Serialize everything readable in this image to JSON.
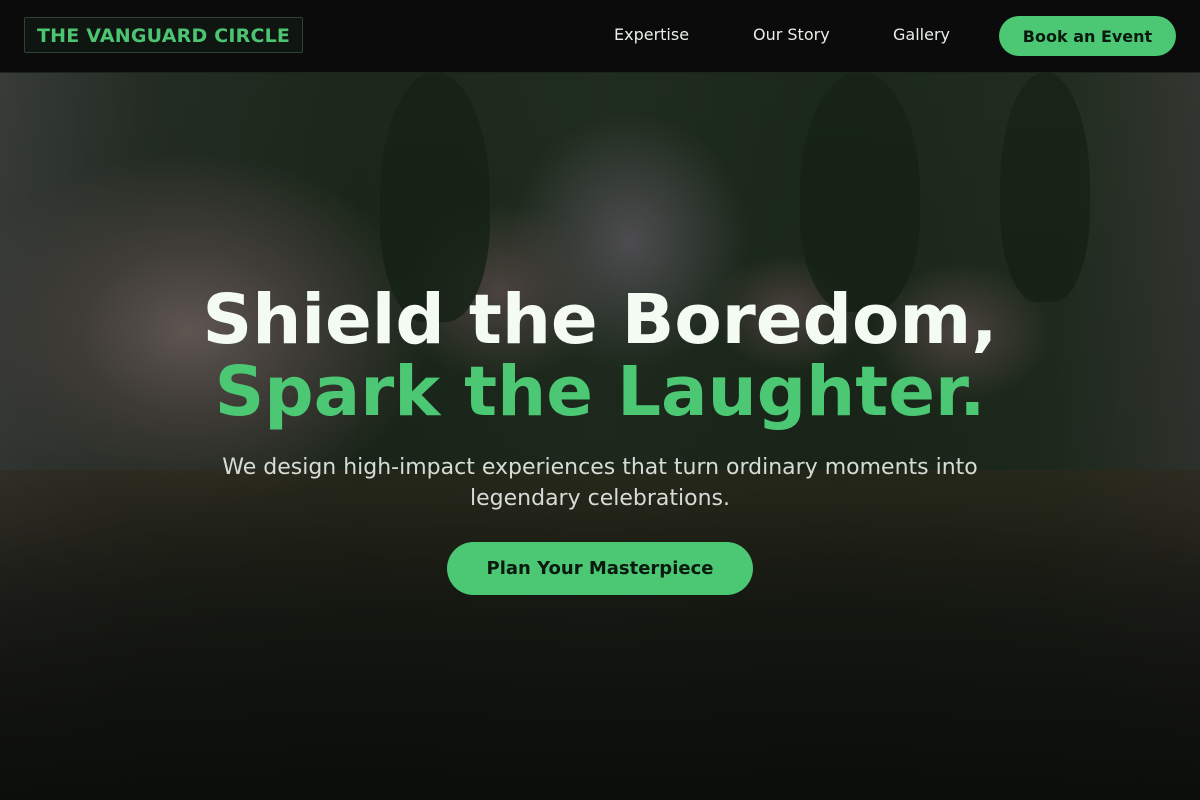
{
  "brand": {
    "logo_text": "THE VANGUARD CIRCLE"
  },
  "nav": {
    "links": [
      {
        "label": "Expertise"
      },
      {
        "label": "Our Story"
      },
      {
        "label": "Gallery"
      }
    ],
    "cta_label": "Book an Event"
  },
  "hero": {
    "headline_line1": "Shield the Boredom,",
    "headline_line2": "Spark the Laughter.",
    "subtitle": "We design high-impact experiences that turn ordinary moments into legendary celebrations.",
    "cta_label": "Plan Your Masterpiece"
  },
  "colors": {
    "accent": "#4cc774",
    "nav_background": "#0a0b0a",
    "headline": "#f3fbf3"
  }
}
